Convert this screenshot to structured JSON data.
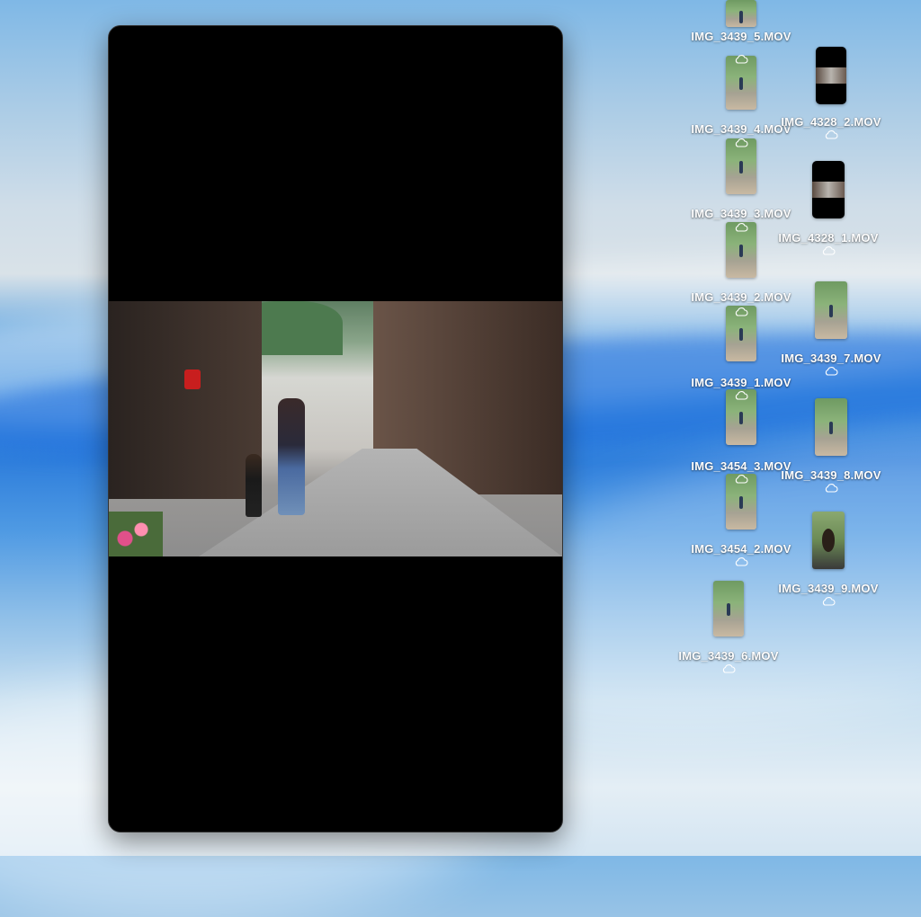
{
  "player": {
    "content": "video-frame"
  },
  "files": [
    {
      "name": "IMG_3439_5.MOV",
      "thumb": "green",
      "cloud": false
    },
    {
      "name": "IMG_3439_4.MOV",
      "thumb": "green",
      "cloud": true
    },
    {
      "name": "IMG_3439_3.MOV",
      "thumb": "green",
      "cloud": false
    },
    {
      "name": "IMG_3439_2.MOV",
      "thumb": "green",
      "cloud": true
    },
    {
      "name": "IMG_3439_1.MOV",
      "thumb": "green",
      "cloud": false
    },
    {
      "name": "IMG_3454_3.MOV",
      "thumb": "green",
      "cloud": false
    },
    {
      "name": "IMG_3454_2.MOV",
      "thumb": "green",
      "cloud": true
    },
    {
      "name": "IMG_3439_6.MOV",
      "thumb": "green",
      "cloud": true
    },
    {
      "name": "IMG_4328_2.MOV",
      "thumb": "dark",
      "cloud": true
    },
    {
      "name": "IMG_4328_1.MOV",
      "thumb": "dark",
      "cloud": true
    },
    {
      "name": "IMG_3439_7.MOV",
      "thumb": "green",
      "cloud": true
    },
    {
      "name": "IMG_3439_8.MOV",
      "thumb": "green",
      "cloud": true
    },
    {
      "name": "IMG_3439_9.MOV",
      "thumb": "kid",
      "cloud": true
    }
  ]
}
